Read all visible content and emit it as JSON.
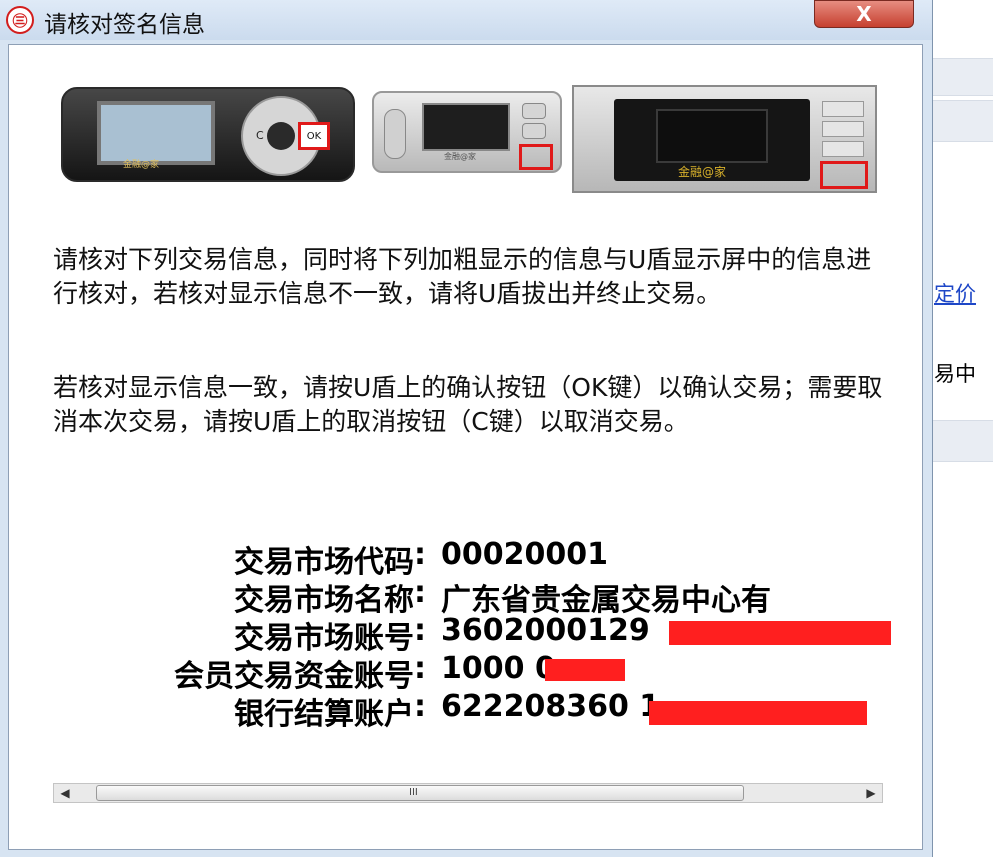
{
  "window": {
    "logo_text": "㊂",
    "title": "请核对签名信息",
    "close_label": "X"
  },
  "devices": {
    "dev1_brand": "金融@家",
    "dev1_ok": "OK",
    "dev1_c": "C",
    "dev2_brand": "金融@家",
    "dev3_brand": "金融@家"
  },
  "instructions": {
    "p1": "  请核对下列交易信息，同时将下列加粗显示的信息与U盾显示屏中的信息进行核对，若核对显示信息不一致，请将U盾拔出并终止交易。",
    "p2": "  若核对显示信息一致，请按U盾上的确认按钮（OK键）以确认交易；需要取消本次交易，请按U盾上的取消按钮（C键）以取消交易。"
  },
  "info": {
    "rows": [
      {
        "label": "交易市场代码",
        "value": "00020001"
      },
      {
        "label": "交易市场名称",
        "value": "广东省贵金属交易中心有"
      },
      {
        "label": "交易市场账号",
        "value": "3602000129"
      },
      {
        "label": "会员交易资金账号",
        "value": "1000    0"
      },
      {
        "label": "银行结算账户",
        "value": "622208360        1"
      }
    ],
    "colon": ":"
  },
  "scrollbar": {
    "left_arrow": "◀",
    "right_arrow": "▶",
    "grip": "III"
  },
  "background_app": {
    "link_text": "定价",
    "text": "易中"
  }
}
